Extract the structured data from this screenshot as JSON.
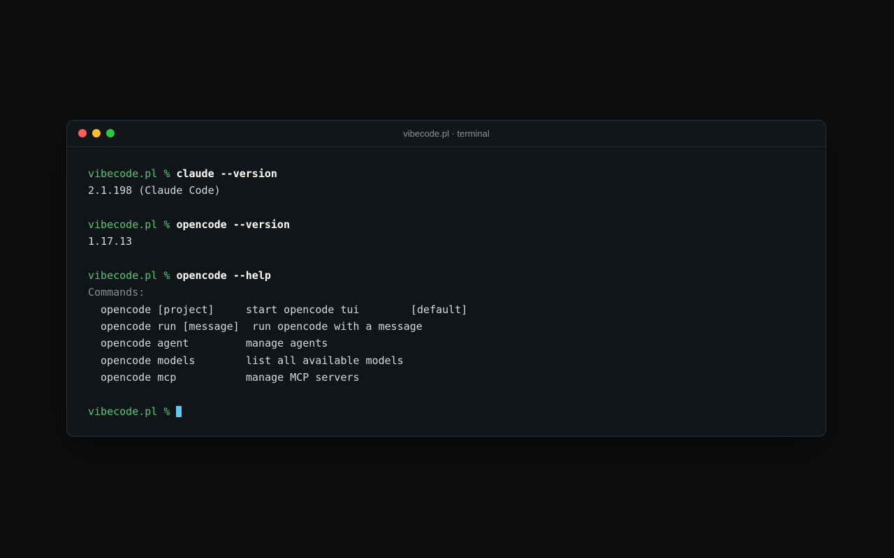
{
  "window": {
    "title": "vibecode.pl · terminal",
    "colors": {
      "close": "#ff5f57",
      "minimize": "#febc2e",
      "zoom": "#28c840"
    }
  },
  "terminal": {
    "prompt": "vibecode.pl % ",
    "blocks": [
      {
        "command": "claude --version",
        "output": "2.1.198 (Claude Code)"
      },
      {
        "command": "opencode --version",
        "output": "1.17.13"
      },
      {
        "command": "opencode --help",
        "output_header": "Commands:"
      }
    ],
    "help_rows": [
      {
        "cmd": "opencode [project]",
        "desc": "start opencode tui",
        "extra": "[default]"
      },
      {
        "cmd": "opencode run [message]",
        "desc": "run opencode with a message",
        "extra": ""
      },
      {
        "cmd": "opencode agent",
        "desc": "manage agents",
        "extra": ""
      },
      {
        "cmd": "opencode models",
        "desc": "list all available models",
        "extra": ""
      },
      {
        "cmd": "opencode mcp",
        "desc": "manage MCP servers",
        "extra": ""
      }
    ],
    "colors": {
      "prompt": "#4ec97a",
      "cursor": "#5ec8f0"
    }
  }
}
